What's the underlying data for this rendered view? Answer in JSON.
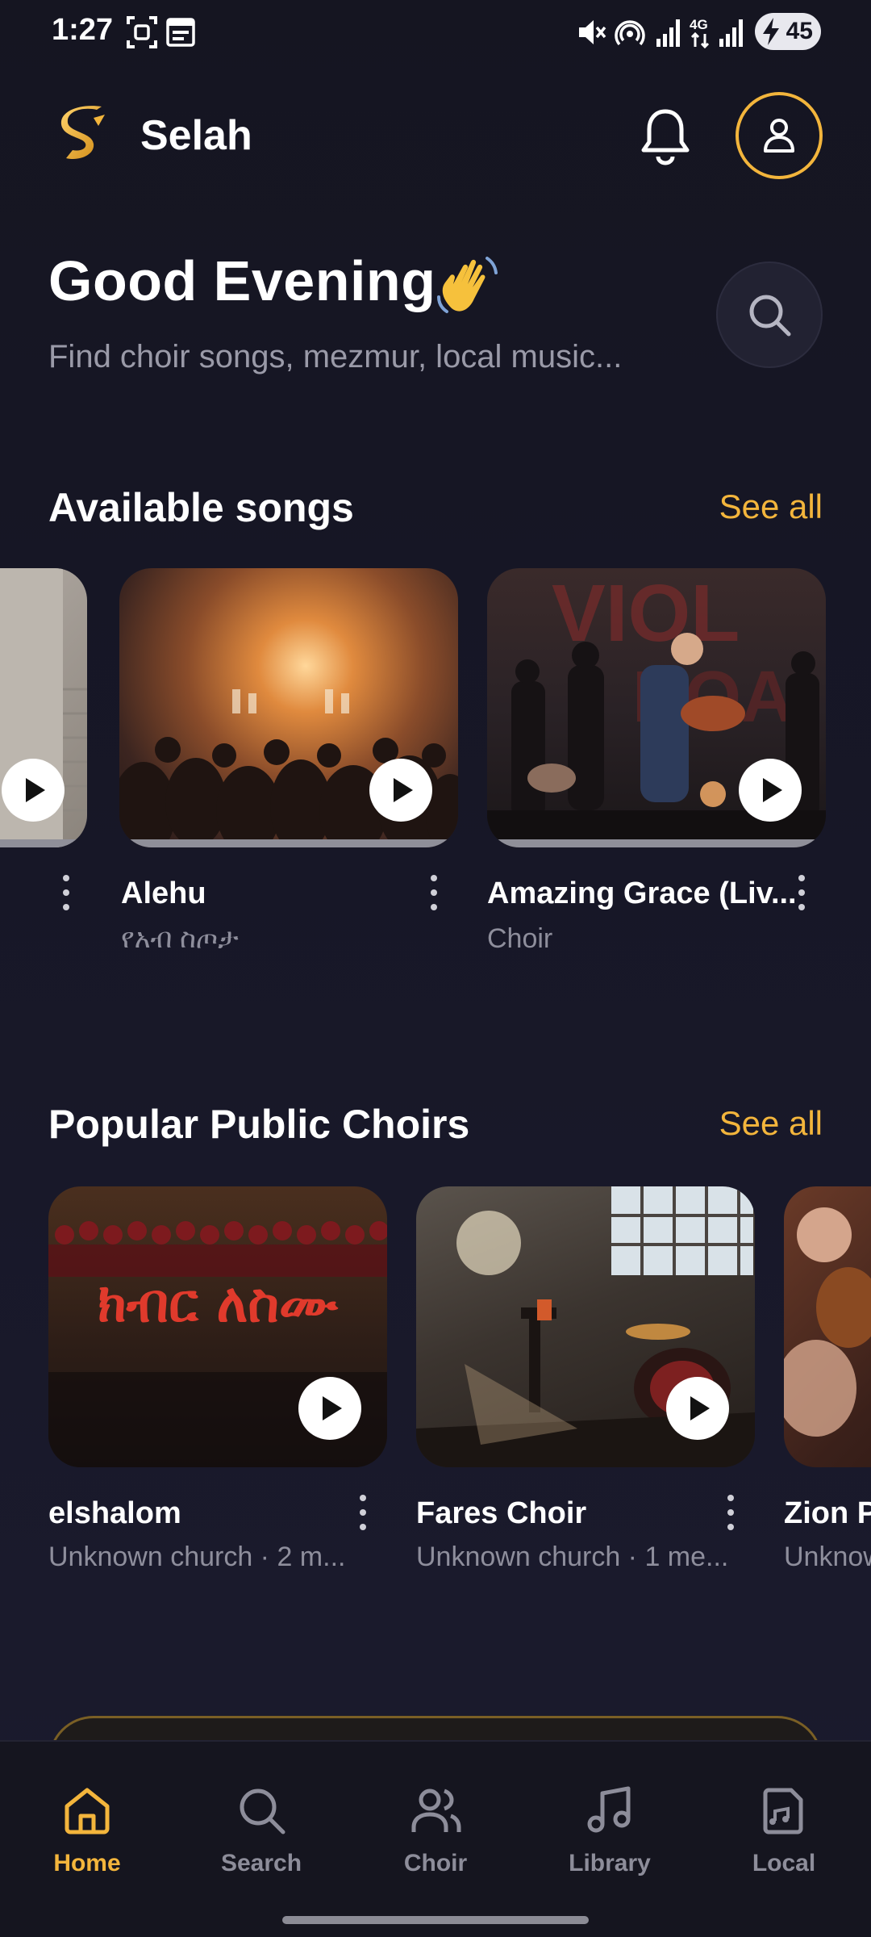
{
  "status_bar": {
    "time": "1:27",
    "battery": "45"
  },
  "header": {
    "app_name": "Selah",
    "brand_color": "#f3b53c"
  },
  "greeting": {
    "title": "Good Evening",
    "subtitle": "Find choir songs, mezmur, local music..."
  },
  "available_songs": {
    "title": "Available songs",
    "see_all": "See all",
    "items": [
      {
        "title": "",
        "subtitle": ""
      },
      {
        "title": "Alehu",
        "subtitle": "የአብ ስጦታ"
      },
      {
        "title": "Amazing Grace (Liv...",
        "subtitle": "Choir"
      }
    ]
  },
  "popular_choirs": {
    "title": "Popular Public Choirs",
    "see_all": "See all",
    "items": [
      {
        "title": "elshalom",
        "subtitle": "Unknown church · 2 m..."
      },
      {
        "title": "Fares Choir",
        "subtitle": "Unknown church · 1 me..."
      },
      {
        "title": "Zion P",
        "subtitle": "Unknow"
      }
    ],
    "poster_text": "ክብር ለስሙ"
  },
  "bottom_nav": {
    "items": [
      {
        "label": "Home",
        "icon": "home-icon",
        "active": true
      },
      {
        "label": "Search",
        "icon": "search-icon",
        "active": false
      },
      {
        "label": "Choir",
        "icon": "users-icon",
        "active": false
      },
      {
        "label": "Library",
        "icon": "music-note-icon",
        "active": false
      },
      {
        "label": "Local",
        "icon": "local-music-icon",
        "active": false
      }
    ]
  }
}
